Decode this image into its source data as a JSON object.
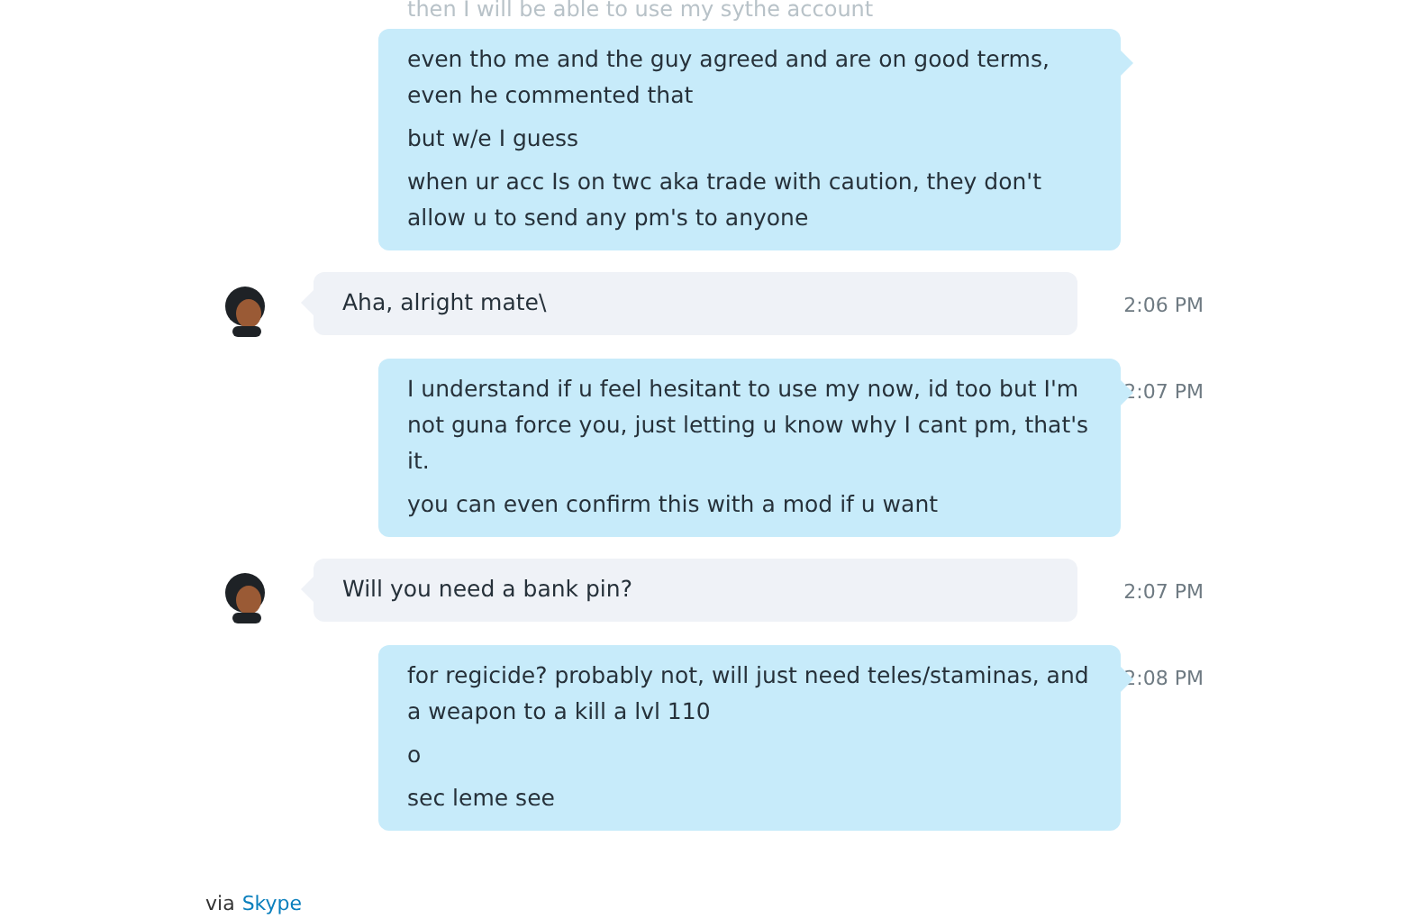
{
  "faded_line": "then I will be able to use my sythe account",
  "messages": [
    {
      "kind": "outgoing",
      "lines": [
        "even tho me and the guy agreed and are on good terms, even he commented that",
        "but w/e I guess",
        "when ur acc Is on twc aka trade with caution, they don't allow u to send any pm's to anyone"
      ]
    },
    {
      "kind": "incoming",
      "time": "2:06 PM",
      "lines": [
        "Aha, alright mate\\"
      ]
    },
    {
      "kind": "outgoing",
      "time": "2:07 PM",
      "lines": [
        "I understand if u feel hesitant to use my now, id too but I'm not guna force you, just letting u know why I cant pm, that's it.",
        "you can even confirm this with a mod if u want"
      ]
    },
    {
      "kind": "incoming",
      "time": "2:07 PM",
      "lines": [
        "Will you need a bank pin?"
      ]
    },
    {
      "kind": "outgoing",
      "time": "2:08 PM",
      "lines": [
        "for regicide? probably not, will just need teles/staminas, and a weapon to a kill a lvl 110",
        "o",
        "sec leme see"
      ]
    }
  ],
  "footer": {
    "prefix": "via",
    "link": "Skype"
  }
}
